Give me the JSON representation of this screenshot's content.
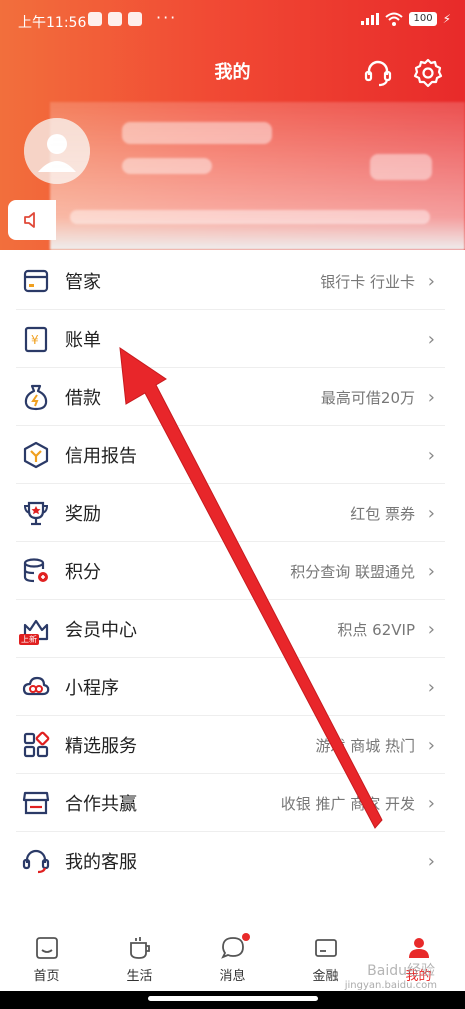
{
  "status": {
    "time": "上午11:56",
    "more": "···",
    "battery": "100"
  },
  "header": {
    "title": "我的"
  },
  "menu": [
    {
      "label": "管家",
      "right": "银行卡 行业卡",
      "icon": "card-icon"
    },
    {
      "label": "账单",
      "right": "",
      "icon": "bill-icon"
    },
    {
      "label": "借款",
      "right": "最高可借20万",
      "icon": "loan-bag-icon"
    },
    {
      "label": "信用报告",
      "right": "",
      "icon": "credit-report-icon"
    },
    {
      "label": "奖励",
      "right": "红包 票券",
      "icon": "trophy-icon"
    },
    {
      "label": "积分",
      "right": "积分查询 联盟通兑",
      "icon": "points-icon"
    },
    {
      "label": "会员中心",
      "right": "积点 62VIP",
      "icon": "vip-crown-icon",
      "badge": "上新"
    },
    {
      "label": "小程序",
      "right": "",
      "icon": "cloud-icon"
    },
    {
      "label": "精选服务",
      "right": "游戏 商城 热门",
      "icon": "grid-icon"
    },
    {
      "label": "合作共赢",
      "right": "收银 推广 商家 开发",
      "icon": "shop-icon"
    },
    {
      "label": "我的客服",
      "right": "",
      "icon": "headset-icon"
    }
  ],
  "nav": [
    {
      "label": "首页",
      "icon": "home-icon"
    },
    {
      "label": "生活",
      "icon": "cup-icon"
    },
    {
      "label": "消息",
      "icon": "message-icon"
    },
    {
      "label": "金融",
      "icon": "finance-icon"
    },
    {
      "label": "我的",
      "icon": "user-icon",
      "active": true
    }
  ],
  "watermark": {
    "text": "Baidu经验",
    "url": "jingyan.baidu.com"
  },
  "colors": {
    "brand": "#e82a2a",
    "header_start": "#f26f3c",
    "icon_blue": "#2b3a67",
    "icon_orange": "#f0a020"
  }
}
